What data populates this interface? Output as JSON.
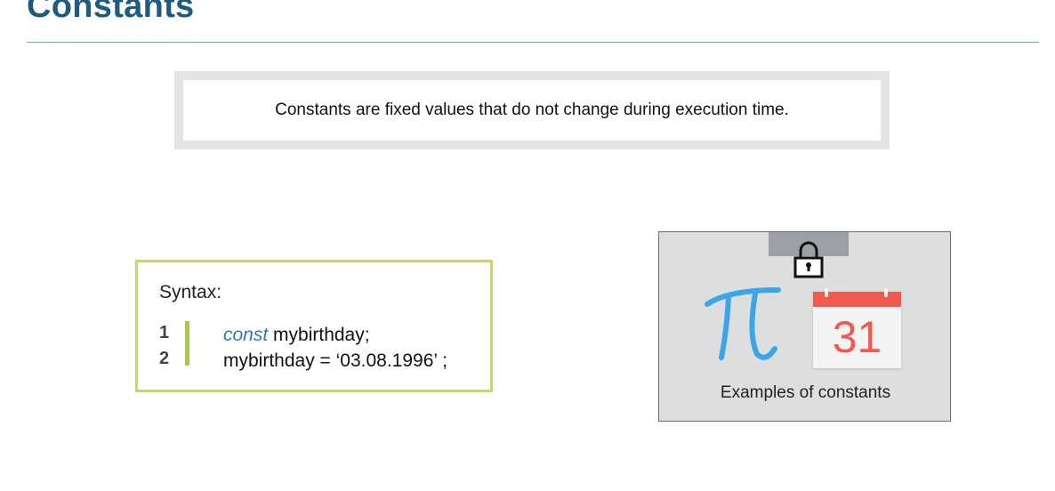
{
  "slide": {
    "title": "Constants",
    "definition": "Constants are fixed values that do not change during execution time."
  },
  "syntax": {
    "label": "Syntax:",
    "lines": [
      {
        "number": "1",
        "keyword": "const",
        "rest": " mybirthday;"
      },
      {
        "number": "2",
        "keyword": "",
        "rest": "mybirthday = ‘03.08.1996’ ;"
      }
    ]
  },
  "examples": {
    "caption": "Examples of constants",
    "calendar_day": "31",
    "icons": [
      "lock-icon",
      "pi-icon",
      "calendar-icon"
    ],
    "colors": {
      "pi": "#3aa6e8",
      "calendar": "#ef5b50",
      "title": "#1f5b80",
      "code_bar": "#a9c64b"
    }
  }
}
